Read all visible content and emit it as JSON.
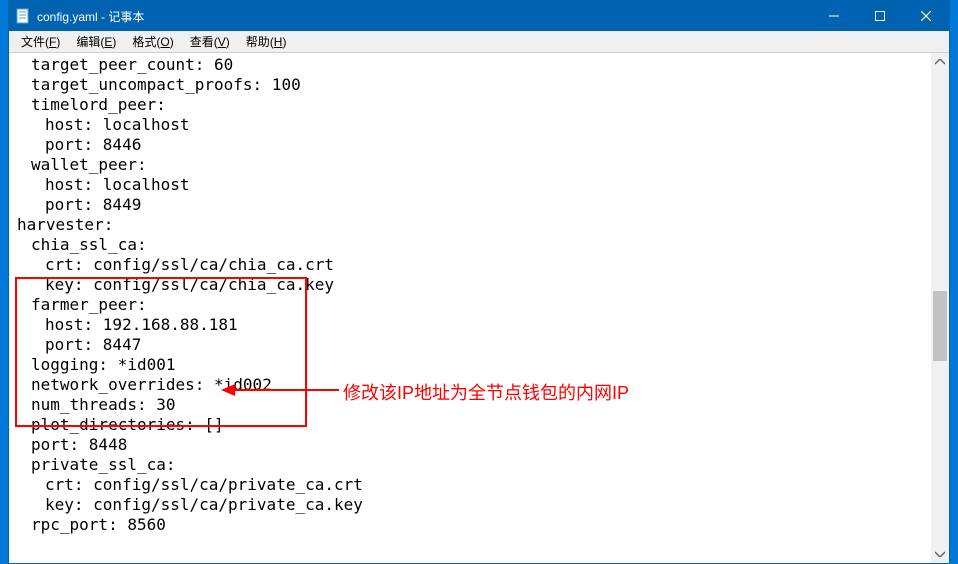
{
  "window": {
    "title": "config.yaml - 记事本"
  },
  "menu": {
    "file": {
      "label": "文件",
      "accel": "F"
    },
    "edit": {
      "label": "编辑",
      "accel": "E"
    },
    "format": {
      "label": "格式",
      "accel": "O"
    },
    "view": {
      "label": "查看",
      "accel": "V"
    },
    "help": {
      "label": "帮助",
      "accel": "H"
    }
  },
  "content": {
    "lines": [
      {
        "indent": 1,
        "text": "target_peer_count: 60"
      },
      {
        "indent": 1,
        "text": "target_uncompact_proofs: 100"
      },
      {
        "indent": 1,
        "text": "timelord_peer:"
      },
      {
        "indent": 2,
        "text": "host: localhost"
      },
      {
        "indent": 2,
        "text": "port: 8446"
      },
      {
        "indent": 1,
        "text": "wallet_peer:"
      },
      {
        "indent": 2,
        "text": "host: localhost"
      },
      {
        "indent": 2,
        "text": "port: 8449"
      },
      {
        "indent": 0,
        "text": "harvester:"
      },
      {
        "indent": 1,
        "text": "chia_ssl_ca:"
      },
      {
        "indent": 2,
        "text": "crt: config/ssl/ca/chia_ca.crt"
      },
      {
        "indent": 2,
        "text": "key: config/ssl/ca/chia_ca.key"
      },
      {
        "indent": 1,
        "text": "farmer_peer:"
      },
      {
        "indent": 2,
        "text": "host: 192.168.88.181"
      },
      {
        "indent": 2,
        "text": "port: 8447"
      },
      {
        "indent": 1,
        "text": "logging: *id001"
      },
      {
        "indent": 1,
        "text": "network_overrides: *id002"
      },
      {
        "indent": 1,
        "text": "num_threads: 30"
      },
      {
        "indent": 1,
        "text": "plot_directories: []"
      },
      {
        "indent": 1,
        "text": "port: 8448"
      },
      {
        "indent": 1,
        "text": "private_ssl_ca:"
      },
      {
        "indent": 2,
        "text": "crt: config/ssl/ca/private_ca.crt"
      },
      {
        "indent": 2,
        "text": "key: config/ssl/ca/private_ca.key"
      },
      {
        "indent": 1,
        "text": "rpc_port: 8560"
      }
    ]
  },
  "annotation": {
    "text": "修改该IP地址为全节点钱包的内网IP",
    "color": "#ff0000"
  }
}
